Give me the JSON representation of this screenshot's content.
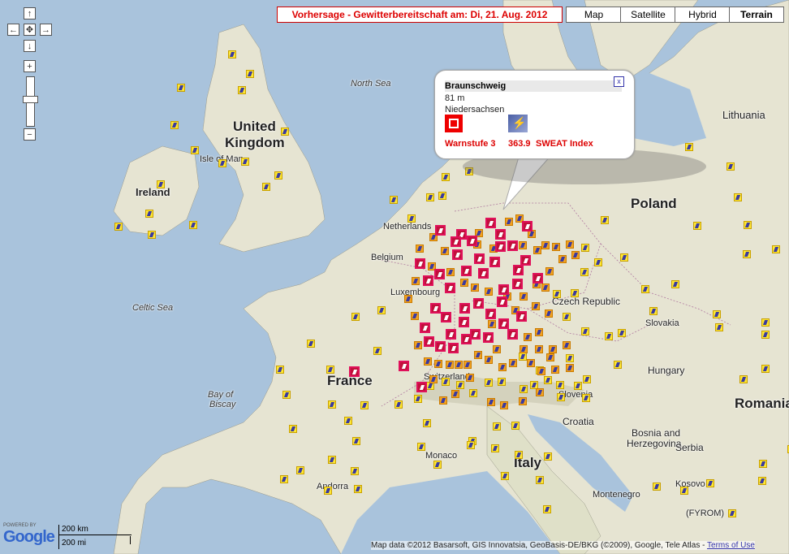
{
  "header": {
    "title": "Vorhersage - Gewitterbereitschaft am: Di, 21. Aug. 2012"
  },
  "map_types": [
    {
      "label": "Map",
      "active": false
    },
    {
      "label": "Satellite",
      "active": false
    },
    {
      "label": "Hybrid",
      "active": false
    },
    {
      "label": "Terrain",
      "active": true
    }
  ],
  "nav": {
    "up": "↑",
    "left": "←",
    "center": "✥",
    "right": "→",
    "down": "↓",
    "zoom_in": "+",
    "zoom_out": "−"
  },
  "labels": {
    "north_sea": "North Sea",
    "united_kingdom_1": "United",
    "united_kingdom_2": "Kingdom",
    "isle_of_man": "Isle of Man",
    "ireland": "Ireland",
    "celtic_sea": "Celtic Sea",
    "netherlands": "Netherlands",
    "belgium": "Belgium",
    "luxembourg": "Luxembourg",
    "france": "France",
    "bay_of_biscay_1": "Bay of",
    "bay_of_biscay_2": "Biscay",
    "poland": "Poland",
    "lithuania": "Lithuania",
    "czech": "Czech Republic",
    "slovakia": "Slovakia",
    "hungary": "Hungary",
    "romania": "Romania",
    "slovenia": "Slovenia",
    "croatia": "Croatia",
    "bosnia_1": "Bosnia and",
    "bosnia_2": "Herzegovina",
    "serbia": "Serbia",
    "kosovo": "Kosovo",
    "macedonia": "(FYROM)",
    "montenegro": "Montenegro",
    "italy": "Italy",
    "monaco": "Monaco",
    "andorra": "Andorra",
    "switzerland": "Switzerland"
  },
  "popup": {
    "title": "Braunschweig",
    "altitude": "81 m",
    "region": "Niedersachsen",
    "warn_level": "Warnstufe 3",
    "sweat_value": "363.9",
    "sweat_label": "SWEAT Index",
    "close": "x"
  },
  "scale": {
    "km": "200 km",
    "mi": "200 mi"
  },
  "branding": {
    "powered_by": "POWERED BY",
    "google": "Google"
  },
  "copyright": {
    "text": "Map data ©2012 Basarsoft, GIS Innovatsia, GeoBasis-DE/BKG (©2009), Google, Tele Atlas - ",
    "terms": "Terms of Use"
  },
  "colors": {
    "sea": "#a9c3dc",
    "land": "#e8e6d6",
    "title_red": "#dd0000",
    "icon_yellow": "#ffe733",
    "icon_warn": "#c0103a",
    "icon_mid": "#f3a320"
  }
}
